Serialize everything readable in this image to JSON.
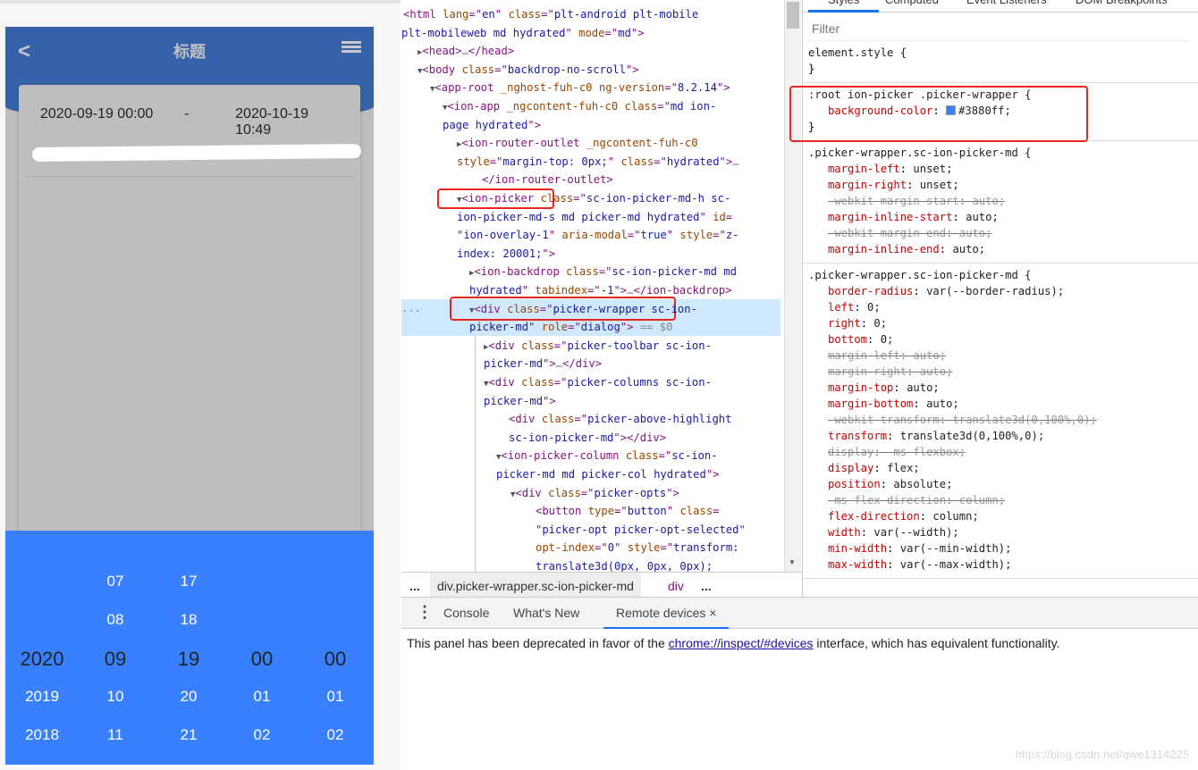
{
  "app": {
    "title": "标题",
    "back_icon": "chevron-left-icon",
    "menu_icon": "list-icon",
    "date_start": "2020-09-19 00:00",
    "date_separator": "-",
    "date_end": "2020-10-19 10:49",
    "header_color": "#3562a8",
    "picker": {
      "background_color": "#3880ff",
      "columns": [
        {
          "options": [
            "",
            "",
            "2020",
            "2019",
            "2018"
          ],
          "selected": "2020"
        },
        {
          "options": [
            "07",
            "08",
            "09",
            "10",
            "11"
          ],
          "selected": "09"
        },
        {
          "options": [
            "17",
            "18",
            "19",
            "20",
            "21"
          ],
          "selected": "19"
        },
        {
          "options": [
            "",
            "",
            "00",
            "01",
            "02"
          ],
          "selected": "00"
        },
        {
          "options": [
            "",
            "",
            "00",
            "01",
            "02"
          ],
          "selected": "00"
        }
      ]
    }
  },
  "devtools": {
    "dom_lines": [
      [
        [
          "t",
          "<html "
        ],
        [
          "a",
          "lang"
        ],
        [
          "t",
          "=\""
        ],
        [
          "v",
          "en"
        ],
        [
          "t",
          "\" "
        ],
        [
          "a",
          "class"
        ],
        [
          "t",
          "=\""
        ],
        [
          "v",
          "plt-android plt-mobile"
        ]
      ],
      [
        [
          "v",
          "plt-mobileweb md hydrated"
        ],
        [
          "t",
          "\" "
        ],
        [
          "a",
          "mode"
        ],
        [
          "t",
          "=\""
        ],
        [
          "v",
          "md"
        ],
        [
          "t",
          "\">"
        ]
      ],
      [
        [
          "tri",
          "▶"
        ],
        [
          "t",
          "<head>"
        ],
        [
          "g",
          "…"
        ],
        [
          "t",
          "</head>"
        ]
      ],
      [
        [
          "tri",
          "▼"
        ],
        [
          "t",
          "<body "
        ],
        [
          "a",
          "class"
        ],
        [
          "t",
          "=\""
        ],
        [
          "v",
          "backdrop-no-scroll"
        ],
        [
          "t",
          "\">"
        ]
      ],
      [
        [
          "tri",
          "▼"
        ],
        [
          "t",
          "<app-root "
        ],
        [
          "a",
          "_nghost-fuh-c0 ng-version"
        ],
        [
          "t",
          "=\""
        ],
        [
          "v",
          "8.2.14"
        ],
        [
          "t",
          "\">"
        ]
      ],
      [
        [
          "tri",
          "▼"
        ],
        [
          "t",
          "<ion-app "
        ],
        [
          "a",
          "_ngcontent-fuh-c0 class"
        ],
        [
          "t",
          "=\""
        ],
        [
          "v",
          "md ion-"
        ]
      ],
      [
        [
          "v",
          "page hydrated"
        ],
        [
          "t",
          "\">"
        ]
      ],
      [
        [
          "tri",
          "▶"
        ],
        [
          "t",
          "<ion-router-outlet "
        ],
        [
          "a",
          "_ngcontent-fuh-c0"
        ]
      ],
      [
        [
          "a",
          "style"
        ],
        [
          "t",
          "=\""
        ],
        [
          "v",
          "margin-top: 0px;"
        ],
        [
          "t",
          "\" "
        ],
        [
          "a",
          "class"
        ],
        [
          "t",
          "=\""
        ],
        [
          "v",
          "hydrated"
        ],
        [
          "t",
          "\">"
        ],
        [
          "g",
          "…"
        ]
      ],
      [
        [
          "t",
          "</ion-router-outlet>"
        ]
      ],
      [
        [
          "tri",
          "▼"
        ],
        [
          "t",
          "<ion-picker "
        ],
        [
          "a",
          "class"
        ],
        [
          "t",
          "=\""
        ],
        [
          "v",
          "sc-ion-picker-md-h sc-"
        ]
      ],
      [
        [
          "v",
          "ion-picker-md-s md picker-md hydrated"
        ],
        [
          "t",
          "\" "
        ],
        [
          "a",
          "id"
        ],
        [
          "t",
          "="
        ]
      ],
      [
        [
          "t",
          "\""
        ],
        [
          "v",
          "ion-overlay-1"
        ],
        [
          "t",
          "\" "
        ],
        [
          "a",
          "aria-modal"
        ],
        [
          "t",
          "=\""
        ],
        [
          "v",
          "true"
        ],
        [
          "t",
          "\" "
        ],
        [
          "a",
          "style"
        ],
        [
          "t",
          "=\""
        ],
        [
          "v",
          "z-"
        ]
      ],
      [
        [
          "v",
          "index: 20001;"
        ],
        [
          "t",
          "\">"
        ]
      ],
      [
        [
          "tri",
          "▶"
        ],
        [
          "t",
          "<ion-backdrop "
        ],
        [
          "a",
          "class"
        ],
        [
          "t",
          "=\""
        ],
        [
          "v",
          "sc-ion-picker-md md"
        ]
      ],
      [
        [
          "v",
          "hydrated"
        ],
        [
          "t",
          "\" "
        ],
        [
          "a",
          "tabindex"
        ],
        [
          "t",
          "=\""
        ],
        [
          "v",
          "-1"
        ],
        [
          "t",
          "\">"
        ],
        [
          "g",
          "…"
        ],
        [
          "t",
          "</ion-backdrop>"
        ]
      ],
      [
        [
          "tri",
          "▼"
        ],
        [
          "t",
          "<div "
        ],
        [
          "a",
          "class"
        ],
        [
          "t",
          "=\""
        ],
        [
          "v",
          "picker-wrapper sc-ion-"
        ]
      ],
      [
        [
          "v",
          "picker-md"
        ],
        [
          "t",
          "\" "
        ],
        [
          "a",
          "role"
        ],
        [
          "t",
          "=\""
        ],
        [
          "v",
          "dialog"
        ],
        [
          "t",
          "\">"
        ],
        [
          "g",
          " == $0"
        ]
      ],
      [
        [
          "tri",
          "▶"
        ],
        [
          "t",
          "<div "
        ],
        [
          "a",
          "class"
        ],
        [
          "t",
          "=\""
        ],
        [
          "v",
          "picker-toolbar sc-ion-"
        ]
      ],
      [
        [
          "v",
          "picker-md"
        ],
        [
          "t",
          "\">"
        ],
        [
          "g",
          "…"
        ],
        [
          "t",
          "</div>"
        ]
      ],
      [
        [
          "tri",
          "▼"
        ],
        [
          "t",
          "<div "
        ],
        [
          "a",
          "class"
        ],
        [
          "t",
          "=\""
        ],
        [
          "v",
          "picker-columns sc-ion-"
        ]
      ],
      [
        [
          "v",
          "picker-md"
        ],
        [
          "t",
          "\">"
        ]
      ],
      [
        [
          "t",
          "<div "
        ],
        [
          "a",
          "class"
        ],
        [
          "t",
          "=\""
        ],
        [
          "v",
          "picker-above-highlight"
        ]
      ],
      [
        [
          "v",
          "sc-ion-picker-md"
        ],
        [
          "t",
          "\"></div>"
        ]
      ],
      [
        [
          "tri",
          "▼"
        ],
        [
          "t",
          "<ion-picker-column "
        ],
        [
          "a",
          "class"
        ],
        [
          "t",
          "=\""
        ],
        [
          "v",
          "sc-ion-"
        ]
      ],
      [
        [
          "v",
          "picker-md md picker-col hydrated"
        ],
        [
          "t",
          "\">"
        ]
      ],
      [
        [
          "tri",
          "▼"
        ],
        [
          "t",
          "<div "
        ],
        [
          "a",
          "class"
        ],
        [
          "t",
          "=\""
        ],
        [
          "v",
          "picker-opts"
        ],
        [
          "t",
          "\">"
        ]
      ],
      [
        [
          "t",
          "<button "
        ],
        [
          "a",
          "type"
        ],
        [
          "t",
          "=\""
        ],
        [
          "v",
          "button"
        ],
        [
          "t",
          "\" "
        ],
        [
          "a",
          "class"
        ],
        [
          "t",
          "="
        ]
      ],
      [
        [
          "t",
          "\""
        ],
        [
          "v",
          "picker-opt picker-opt-selected"
        ],
        [
          "t",
          "\""
        ]
      ],
      [
        [
          "a",
          "opt-index"
        ],
        [
          "t",
          "=\""
        ],
        [
          "v",
          "0"
        ],
        [
          "t",
          "\" "
        ],
        [
          "a",
          "style"
        ],
        [
          "t",
          "=\""
        ],
        [
          "v",
          "transform:"
        ]
      ],
      [
        [
          "v",
          "translate3d(0px, 0px, 0px);"
        ]
      ]
    ],
    "selected_marker": "...",
    "styles_tabs": [
      "Styles",
      "Computed",
      "Event Listeners",
      "DOM Breakpoints"
    ],
    "filter_placeholder": "Filter",
    "rules": [
      {
        "selector": "element.style {",
        "props": []
      },
      {
        "selector": ":root ion-picker .picker-wrapper {",
        "props": [
          {
            "name": "background-color",
            "value": "#3880ff;",
            "swatch": "#3880ff"
          }
        ]
      },
      {
        "selector": ".picker-wrapper.sc-ion-picker-md {",
        "props": [
          {
            "name": "margin-left",
            "value": "unset;"
          },
          {
            "name": "margin-right",
            "value": "unset;"
          },
          {
            "name": "-webkit-margin-start",
            "value": "auto;",
            "struck": true
          },
          {
            "name": "margin-inline-start",
            "value": "auto;"
          },
          {
            "name": "-webkit-margin-end",
            "value": "auto;",
            "struck": true
          },
          {
            "name": "margin-inline-end",
            "value": "auto;"
          }
        ]
      },
      {
        "selector": ".picker-wrapper.sc-ion-picker-md {",
        "props": [
          {
            "name": "border-radius",
            "value": "var(--border-radius);"
          },
          {
            "name": "left",
            "value": "0;"
          },
          {
            "name": "right",
            "value": "0;"
          },
          {
            "name": "bottom",
            "value": "0;"
          },
          {
            "name": "margin-left",
            "value": "auto;",
            "struck": true
          },
          {
            "name": "margin-right",
            "value": "auto;",
            "struck": true
          },
          {
            "name": "margin-top",
            "value": "auto;"
          },
          {
            "name": "margin-bottom",
            "value": "auto;"
          },
          {
            "name": "-webkit-transform",
            "value": "translate3d(0,100%,0);",
            "struck": true
          },
          {
            "name": "transform",
            "value": "translate3d(0,100%,0);"
          },
          {
            "name": "display",
            "value": "-ms-flexbox;",
            "struck": true
          },
          {
            "name": "display",
            "value": "flex;"
          },
          {
            "name": "position",
            "value": "absolute;"
          },
          {
            "name": "-ms-flex-direction",
            "value": "column;",
            "struck": true
          },
          {
            "name": "flex-direction",
            "value": "column;"
          },
          {
            "name": "width",
            "value": "var(--width);"
          },
          {
            "name": "min-width",
            "value": "var(--min-width);"
          },
          {
            "name": "max-width",
            "value": "var(--max-width);"
          }
        ]
      }
    ],
    "breadcrumbs": [
      "...",
      "div.picker-wrapper.sc-ion-picker-md",
      "div",
      "..."
    ],
    "drawer_tabs": [
      "Console",
      "What's New",
      "Remote devices"
    ],
    "drawer_close": "×",
    "drawer_message_before": "This panel has been deprecated in favor of the ",
    "drawer_link": "chrome://inspect/#devices",
    "drawer_message_after": " interface, which has equivalent functionality.",
    "watermark": "https://blog.csdn.net/qwe1314225"
  }
}
